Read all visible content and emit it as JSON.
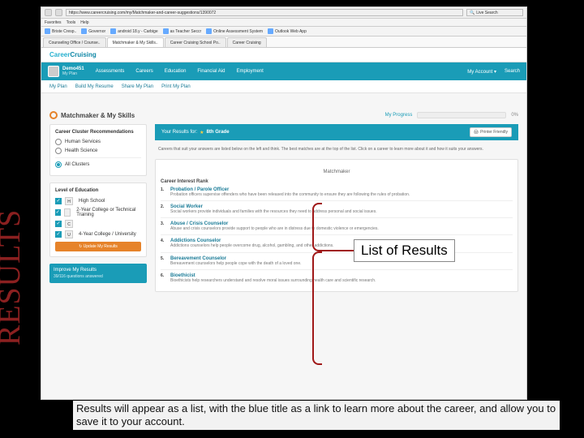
{
  "slide": {
    "vertical_label": "RESULTS",
    "callout": "List of Results",
    "caption": "Results will appear as a list, with the blue title as a link to learn more about the career, and allow you to save it to your account."
  },
  "browser": {
    "url": "https://www.careercruising.com/my/Matchmaker-and-career-suggestions/1390072",
    "menu": {
      "favorites": "Favorites",
      "tools": "Tools",
      "help": "Help"
    },
    "search_placeholder": "Live Search",
    "bookmarks": [
      "Briste Cresp..",
      "Governor",
      "android 18.y - Carbige",
      "as Teacher Seccr",
      "Online Assessment System",
      "Outlook Web App"
    ],
    "tabs": [
      "Counseling Office / Counse..",
      "Matchmaker & My Skills..",
      "Career Cruising School Po..",
      "Career Cruising"
    ]
  },
  "app": {
    "brand": {
      "a": "Career",
      "b": "Cruising"
    },
    "user": {
      "name": "Demo451",
      "subtitle": "My Plan"
    },
    "nav": [
      "Assessments",
      "Careers",
      "Education",
      "Financial Aid",
      "Employment"
    ],
    "navright": [
      "My Account ▾",
      "Search"
    ],
    "subplan": [
      "My Plan",
      "Build My Resume",
      "Share My Plan",
      "Print My Plan"
    ],
    "page_title": "Matchmaker & My Skills",
    "progress_label": "My Progress",
    "progress_pct": "0%",
    "results_for_label": "Your Results for:",
    "results_for_value": "8th Grade",
    "printer_label": "Printer Friendly",
    "intro": "Careers that suit your answers are listed below on the left and think. The best matches are at the top of the list. Click on a career to learn more about it and how it suits your answers.",
    "matchmaker_header": "Matchmaker",
    "interest_header": "Career Interest Rank",
    "results": [
      {
        "n": "1.",
        "title": "Probation / Parole Officer",
        "sub": "Probation officers supervise offenders who have been released into the community to ensure they are following the rules of probation."
      },
      {
        "n": "2.",
        "title": "Social Worker",
        "sub": "Social workers provide individuals and families with the resources they need to address personal and social issues."
      },
      {
        "n": "3.",
        "title": "Abuse / Crisis Counselor",
        "sub": "Abuse and crisis counselors provide support to people who are in distress due to domestic violence or emergencies."
      },
      {
        "n": "4.",
        "title": "Addictions Counselor",
        "sub": "Addictions counselors help people overcome drug, alcohol, gambling, and other addictions."
      },
      {
        "n": "5.",
        "title": "Bereavement Counselor",
        "sub": "Bereavement counselors help people cope with the death of a loved one."
      },
      {
        "n": "6.",
        "title": "Bioethicist",
        "sub": "Bioethicists help researchers understand and resolve moral issues surrounding health care and scientific research."
      }
    ]
  },
  "sidebar": {
    "cluster_title": "Career Cluster Recommendations",
    "clusters": [
      {
        "label": "Human Services",
        "selected": false
      },
      {
        "label": "Health Science",
        "selected": false
      }
    ],
    "all_clusters": "All Clusters",
    "education_title": "Level of Education",
    "levels": [
      {
        "chip": "H",
        "label": "High School"
      },
      {
        "chip": "",
        "label": "2-Year College or Technical Training"
      },
      {
        "chip": "C",
        "label": ""
      },
      {
        "chip": "U",
        "label": "4-Year College / University"
      }
    ],
    "update_btn": "↻ Update My Results",
    "improve_title": "Improve My Results",
    "improve_sub": "39/116 questions answered"
  }
}
